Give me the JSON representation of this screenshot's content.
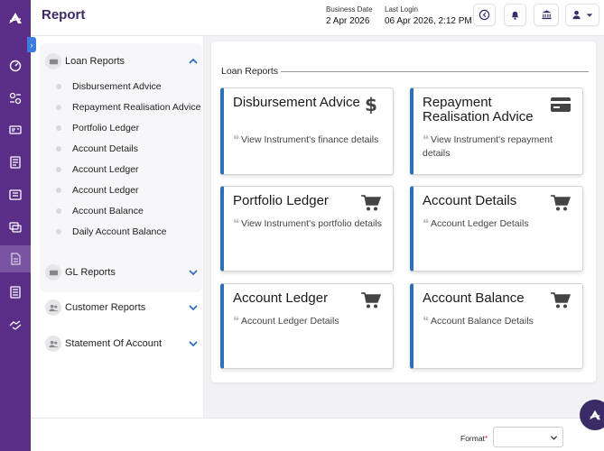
{
  "header": {
    "title": "Report",
    "business_date_label": "Business Date",
    "business_date": "2 Apr 2026",
    "last_login_label": "Last Login",
    "last_login": "06 Apr 2026, 2:12 PM"
  },
  "menu": {
    "loan_reports": {
      "label": "Loan Reports",
      "items": [
        {
          "label": "Disbursement Advice"
        },
        {
          "label": "Repayment Realisation Advice"
        },
        {
          "label": "Portfolio Ledger"
        },
        {
          "label": "Account Details"
        },
        {
          "label": "Account Ledger"
        },
        {
          "label": "Account Ledger"
        },
        {
          "label": "Account Balance"
        },
        {
          "label": "Daily Account Balance"
        }
      ]
    },
    "gl_reports": {
      "label": "GL Reports"
    },
    "customer_reports": {
      "label": "Customer Reports"
    },
    "statement_of_account": {
      "label": "Statement Of Account"
    }
  },
  "content": {
    "section_title": "Loan Reports",
    "cards": [
      {
        "title": "Disbursement Advice",
        "desc": "View Instrument's finance details",
        "icon": "dollar-icon"
      },
      {
        "title": "Repayment Realisation Advice",
        "desc": "View Instrument's repayment details",
        "icon": "credit-card-icon"
      },
      {
        "title": "Portfolio Ledger",
        "desc": "View Instrument's portfolio details",
        "icon": "cart-icon"
      },
      {
        "title": "Account Details",
        "desc": "Account Ledger Details",
        "icon": "cart-icon"
      },
      {
        "title": "Account Ledger",
        "desc": "Account Ledger Details",
        "icon": "cart-icon"
      },
      {
        "title": "Account Balance",
        "desc": "Account Balance Details",
        "icon": "cart-icon"
      }
    ]
  },
  "footer": {
    "format_label": "Format",
    "format_required_mark": "*",
    "format_value": ""
  },
  "colors": {
    "rail": "#5a2d86",
    "title": "#3a2a66",
    "card_accent": "#2f6fb5",
    "toggle": "#3d7be0"
  }
}
